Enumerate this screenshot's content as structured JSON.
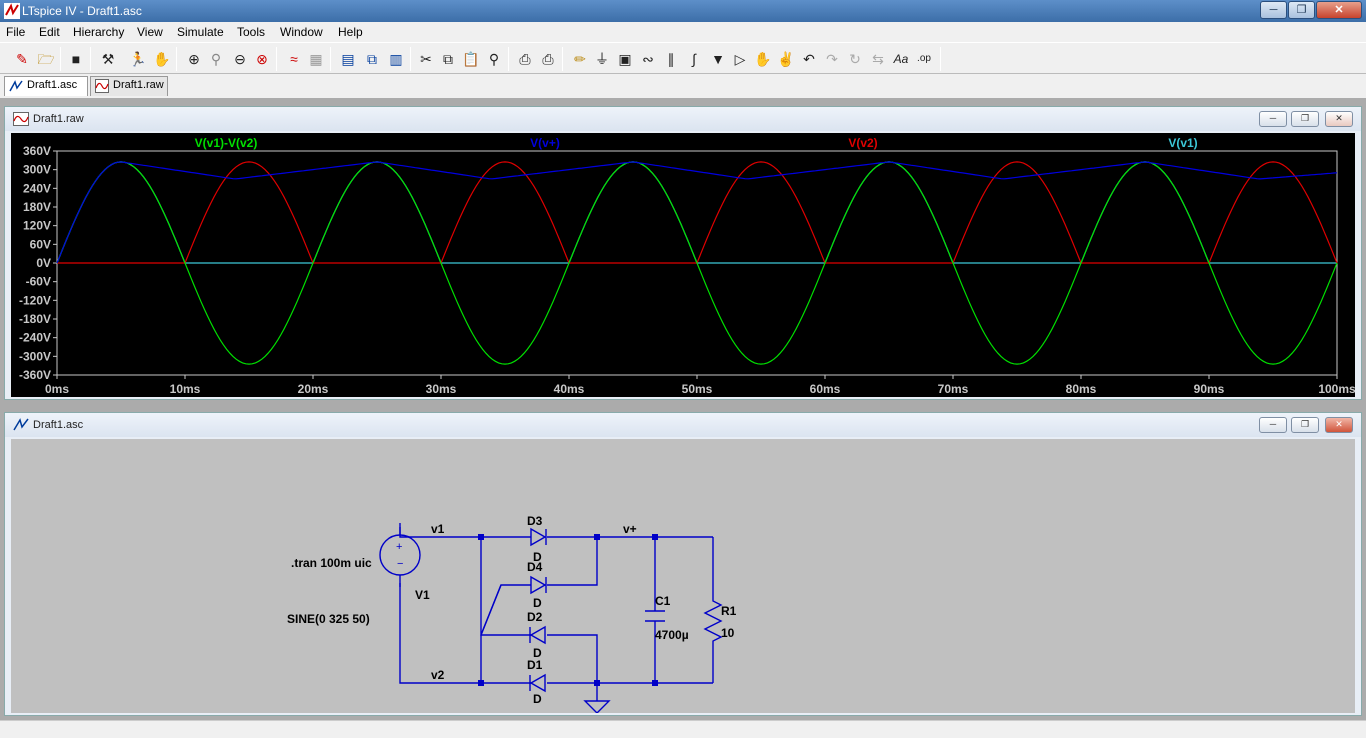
{
  "window": {
    "title": "LTspice IV - Draft1.asc"
  },
  "menu": [
    "File",
    "Edit",
    "Hierarchy",
    "View",
    "Simulate",
    "Tools",
    "Window",
    "Help"
  ],
  "toolbar_icons": [
    "new-schematic-icon",
    "open-icon",
    "save-icon",
    "control-panel-icon",
    "run-icon",
    "pan-icon",
    "zoom-in-icon",
    "zoom-full-icon",
    "zoom-out-icon",
    "autorange-icon",
    "waveform-icon",
    "grid-icon",
    "tile-horizontal-icon",
    "cascade-icon",
    "tile-vertical-icon",
    "cut-icon",
    "copy-icon",
    "paste-icon",
    "find-icon",
    "print-preview-icon",
    "print-icon",
    "draw-wire-icon",
    "ground-icon",
    "label-net-icon",
    "resistor-icon",
    "capacitor-icon",
    "inductor-icon",
    "diode-icon",
    "component-icon",
    "move-icon",
    "drag-icon",
    "undo-icon",
    "redo-icon",
    "rotate-icon",
    "mirror-icon",
    "text-icon",
    "spice-directive-icon"
  ],
  "tabs": [
    {
      "label": "Draft1.asc",
      "active": true,
      "icon": "schematic-icon"
    },
    {
      "label": "Draft1.raw",
      "active": false,
      "icon": "waveform-icon"
    }
  ],
  "wave_window": {
    "title": "Draft1.raw"
  },
  "schematic_window": {
    "title": "Draft1.asc"
  },
  "colors": {
    "v_diff": "#00e000",
    "v_plus": "#0000e0",
    "v_v2": "#e00000",
    "v_v1": "#3cc8d8",
    "axis": "#c8c8c8",
    "wire": "#0000c8"
  },
  "chart_data": {
    "type": "line",
    "xlabel": "",
    "ylabel": "",
    "xlim": [
      0,
      100
    ],
    "ylim": [
      -360,
      360
    ],
    "x_ticks": [
      "0ms",
      "10ms",
      "20ms",
      "30ms",
      "40ms",
      "50ms",
      "60ms",
      "70ms",
      "80ms",
      "90ms",
      "100ms"
    ],
    "y_ticks": [
      "360V",
      "300V",
      "240V",
      "180V",
      "120V",
      "60V",
      "0V",
      "-60V",
      "-120V",
      "-180V",
      "-240V",
      "-300V",
      "-360V"
    ],
    "grid": false,
    "series": [
      {
        "name": "V(v1)-V(v2)",
        "description": "sine, amplitude 325V, 50Hz",
        "amplitude": 325,
        "frequency_hz": 50
      },
      {
        "name": "V(v+)",
        "peak_points": [
          [
            5,
            325
          ],
          [
            13.9,
            270
          ],
          [
            25,
            325
          ],
          [
            33.9,
            270
          ],
          [
            45,
            325
          ],
          [
            53.9,
            270
          ],
          [
            65,
            325
          ],
          [
            73.9,
            270
          ],
          [
            85,
            325
          ],
          [
            93.9,
            270
          ],
          [
            100,
            290
          ]
        ]
      },
      {
        "name": "V(v2)",
        "description": "negative half-cycles rectified onto v2, peak 325V"
      },
      {
        "name": "V(v1)",
        "description": "full-wave rectified version, peak 325V, min 0V"
      }
    ]
  },
  "schematic": {
    "directive": ".tran 100m uic",
    "source": {
      "name": "V1",
      "value": "SINE(0 325 50)"
    },
    "nets": {
      "v1": "v1",
      "v2": "v2",
      "vplus": "v+"
    },
    "diodes": [
      {
        "name": "D3",
        "model": "D"
      },
      {
        "name": "D4",
        "model": "D"
      },
      {
        "name": "D2",
        "model": "D"
      },
      {
        "name": "D1",
        "model": "D"
      }
    ],
    "capacitor": {
      "name": "C1",
      "value": "4700µ"
    },
    "resistor": {
      "name": "R1",
      "value": "10"
    }
  }
}
